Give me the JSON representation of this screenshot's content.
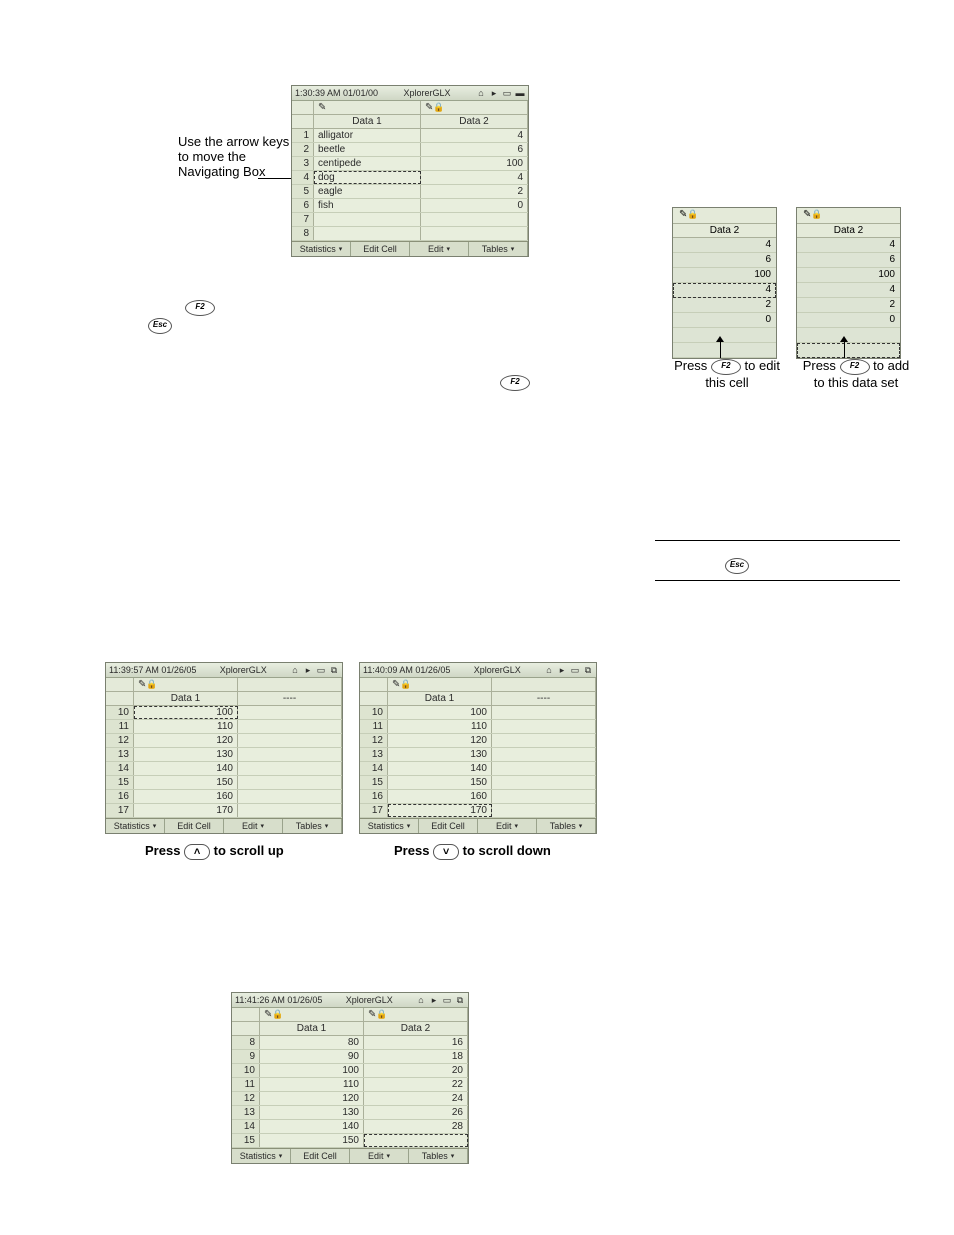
{
  "annotation": {
    "navbox": "Use the arrow keys to move the Navigating Box"
  },
  "f2key": "F2",
  "esckey": "Esc",
  "top_screenshot": {
    "timestamp": "1:30:39 AM  01/01/00",
    "app_title": "XplorerGLX",
    "col1_title": "Data 1",
    "col2_title": "Data 2",
    "rows": [
      {
        "n": "1",
        "a": "alligator",
        "b": "4"
      },
      {
        "n": "2",
        "a": "beetle",
        "b": "6"
      },
      {
        "n": "3",
        "a": "centipede",
        "b": "100"
      },
      {
        "n": "4",
        "a": "dog",
        "b": "4"
      },
      {
        "n": "5",
        "a": "eagle",
        "b": "2"
      },
      {
        "n": "6",
        "a": "fish",
        "b": "0"
      },
      {
        "n": "7",
        "a": "",
        "b": ""
      },
      {
        "n": "8",
        "a": "",
        "b": ""
      }
    ],
    "footer": {
      "f1": "Statistics",
      "f2": "Edit Cell",
      "f3": "Edit",
      "f4": "Tables"
    }
  },
  "mini_left": {
    "title": "Data 2",
    "values": [
      "4",
      "6",
      "100",
      "4",
      "2",
      "0",
      "",
      ""
    ],
    "caption_pre": "Press ",
    "caption_post": " to edit this cell"
  },
  "mini_right": {
    "title": "Data 2",
    "values": [
      "4",
      "6",
      "100",
      "4",
      "2",
      "0",
      "",
      ""
    ],
    "caption_pre": "Press ",
    "caption_post": " to add to this data set"
  },
  "mid_left": {
    "timestamp": "11:39:57 AM  01/26/05",
    "app_title": "XplorerGLX",
    "col1_title": "Data 1",
    "col2_title": "----",
    "rows": [
      {
        "n": "10",
        "a": "100"
      },
      {
        "n": "11",
        "a": "110"
      },
      {
        "n": "12",
        "a": "120"
      },
      {
        "n": "13",
        "a": "130"
      },
      {
        "n": "14",
        "a": "140"
      },
      {
        "n": "15",
        "a": "150"
      },
      {
        "n": "16",
        "a": "160"
      },
      {
        "n": "17",
        "a": "170"
      }
    ],
    "footer": {
      "f1": "Statistics",
      "f2": "Edit Cell",
      "f3": "Edit",
      "f4": "Tables"
    },
    "caption_pre": "Press ",
    "caption_post": " to scroll up"
  },
  "mid_right": {
    "timestamp": "11:40:09 AM  01/26/05",
    "app_title": "XplorerGLX",
    "col1_title": "Data 1",
    "col2_title": "----",
    "rows": [
      {
        "n": "10",
        "a": "100"
      },
      {
        "n": "11",
        "a": "110"
      },
      {
        "n": "12",
        "a": "120"
      },
      {
        "n": "13",
        "a": "130"
      },
      {
        "n": "14",
        "a": "140"
      },
      {
        "n": "15",
        "a": "150"
      },
      {
        "n": "16",
        "a": "160"
      },
      {
        "n": "17",
        "a": "170"
      }
    ],
    "footer": {
      "f1": "Statistics",
      "f2": "Edit Cell",
      "f3": "Edit",
      "f4": "Tables"
    },
    "caption_pre": "Press ",
    "caption_post": " to scroll down"
  },
  "bottom": {
    "timestamp": "11:41:26 AM  01/26/05",
    "app_title": "XplorerGLX",
    "col1_title": "Data 1",
    "col2_title": "Data 2",
    "rows": [
      {
        "n": "8",
        "a": "80",
        "b": "16"
      },
      {
        "n": "9",
        "a": "90",
        "b": "18"
      },
      {
        "n": "10",
        "a": "100",
        "b": "20"
      },
      {
        "n": "11",
        "a": "110",
        "b": "22"
      },
      {
        "n": "12",
        "a": "120",
        "b": "24"
      },
      {
        "n": "13",
        "a": "130",
        "b": "26"
      },
      {
        "n": "14",
        "a": "140",
        "b": "28"
      },
      {
        "n": "15",
        "a": "150",
        "b": ""
      }
    ],
    "footer": {
      "f1": "Statistics",
      "f2": "Edit Cell",
      "f3": "Edit",
      "f4": "Tables"
    }
  },
  "chart_data": {
    "type": "table",
    "tables": [
      {
        "title": "Top",
        "columns": [
          "#",
          "Data 1",
          "Data 2"
        ],
        "rows": [
          [
            1,
            "alligator",
            4
          ],
          [
            2,
            "beetle",
            6
          ],
          [
            3,
            "centipede",
            100
          ],
          [
            4,
            "dog",
            4
          ],
          [
            5,
            "eagle",
            2
          ],
          [
            6,
            "fish",
            0
          ]
        ]
      },
      {
        "title": "Mid-Left",
        "columns": [
          "#",
          "Data 1"
        ],
        "rows": [
          [
            10,
            100
          ],
          [
            11,
            110
          ],
          [
            12,
            120
          ],
          [
            13,
            130
          ],
          [
            14,
            140
          ],
          [
            15,
            150
          ],
          [
            16,
            160
          ],
          [
            17,
            170
          ]
        ]
      },
      {
        "title": "Mid-Right",
        "columns": [
          "#",
          "Data 1"
        ],
        "rows": [
          [
            10,
            100
          ],
          [
            11,
            110
          ],
          [
            12,
            120
          ],
          [
            13,
            130
          ],
          [
            14,
            140
          ],
          [
            15,
            150
          ],
          [
            16,
            160
          ],
          [
            17,
            170
          ]
        ]
      },
      {
        "title": "Bottom",
        "columns": [
          "#",
          "Data 1",
          "Data 2"
        ],
        "rows": [
          [
            8,
            80,
            16
          ],
          [
            9,
            90,
            18
          ],
          [
            10,
            100,
            20
          ],
          [
            11,
            110,
            22
          ],
          [
            12,
            120,
            24
          ],
          [
            13,
            130,
            26
          ],
          [
            14,
            140,
            28
          ],
          [
            15,
            150,
            null
          ]
        ]
      }
    ]
  }
}
